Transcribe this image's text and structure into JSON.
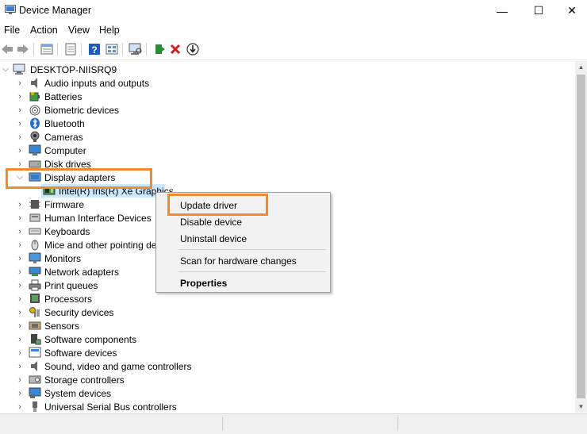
{
  "window": {
    "title": "Device Manager",
    "min_glyph": "—",
    "max_glyph": "☐",
    "close_glyph": "✕"
  },
  "menu": [
    "File",
    "Action",
    "View",
    "Help"
  ],
  "toolbar": {
    "icons": [
      "back-icon",
      "forward-icon",
      "properties-icon",
      "driver-icon",
      "help-icon",
      "grid-icon",
      "scan-hardware-icon",
      "add-driver-icon",
      "uninstall-icon",
      "update-icon"
    ]
  },
  "tree": {
    "root": "DESKTOP-NIISRQ9",
    "items": [
      "Audio inputs and outputs",
      "Batteries",
      "Biometric devices",
      "Bluetooth",
      "Cameras",
      "Computer",
      "Disk drives",
      "Display adapters",
      "Intel(R) Iris(R) Xe Graphics",
      "Firmware",
      "Human Interface Devices",
      "Keyboards",
      "Mice and other pointing devices",
      "Monitors",
      "Network adapters",
      "Print queues",
      "Processors",
      "Security devices",
      "Sensors",
      "Software components",
      "Software devices",
      "Sound, video and game controllers",
      "Storage controllers",
      "System devices",
      "Universal Serial Bus controllers"
    ]
  },
  "context_menu": {
    "update": "Update driver",
    "disable": "Disable device",
    "uninstall": "Uninstall device",
    "scan": "Scan for hardware changes",
    "properties": "Properties"
  },
  "colors": {
    "highlight": "#ef8b2c",
    "selection": "#cce8ff",
    "error_red": "#d11f1f",
    "help_blue": "#1e5bb8"
  }
}
